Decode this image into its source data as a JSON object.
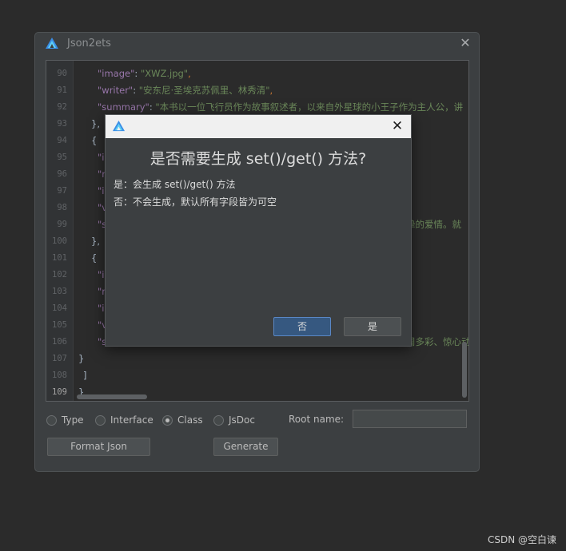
{
  "window": {
    "title": "Json2ets",
    "close_icon": "close-icon"
  },
  "editor": {
    "lines": [
      {
        "num": "90",
        "key": "\"image\"",
        "sep": ": ",
        "val": "\"XWZ.jpg\"",
        "tail": ","
      },
      {
        "num": "91",
        "key": "\"writer\"",
        "sep": ": ",
        "val": "\"安东尼·圣埃克苏佩里、林秀清\"",
        "tail": ","
      },
      {
        "num": "92",
        "key": "\"summary\"",
        "sep": ": ",
        "val": "\"本书以一位飞行员作为故事叙述者，以来自外星球的小王子作为主人公，讲",
        "tail": ""
      },
      {
        "num": "93",
        "plain": "},"
      },
      {
        "num": "94",
        "plain": "{"
      },
      {
        "num": "95",
        "key": "\"i",
        "sep": "",
        "val": "",
        "tail": ""
      },
      {
        "num": "96",
        "key": "\"r",
        "sep": "",
        "val": "",
        "tail": ""
      },
      {
        "num": "97",
        "key": "\"i",
        "sep": "",
        "val": "",
        "tail": ""
      },
      {
        "num": "98",
        "key": "\"v",
        "sep": "",
        "val": "",
        "tail": ""
      },
      {
        "num": "99",
        "key": "\"s",
        "sep": "",
        "val": "",
        "tail": "",
        "right": "挚的爱情。就"
      },
      {
        "num": "100",
        "plain": "},"
      },
      {
        "num": "101",
        "plain": "{"
      },
      {
        "num": "102",
        "key": "\"i",
        "sep": "",
        "val": "",
        "tail": ""
      },
      {
        "num": "103",
        "key": "\"r",
        "sep": "",
        "val": "",
        "tail": ""
      },
      {
        "num": "104",
        "key": "\"i",
        "sep": "",
        "val": "",
        "tail": ""
      },
      {
        "num": "105",
        "key": "\"v",
        "sep": "",
        "val": "",
        "tail": ""
      },
      {
        "num": "106",
        "key": "\"s",
        "sep": "",
        "val": "",
        "tail": "",
        "right": "周多彩、惊心动"
      },
      {
        "num": "107",
        "plain": "}"
      },
      {
        "num": "108",
        "plain": "]"
      },
      {
        "num": "109",
        "plain": "}"
      }
    ]
  },
  "options": {
    "radios": [
      {
        "label": "Type",
        "checked": false
      },
      {
        "label": "Interface",
        "checked": false
      },
      {
        "label": "Class",
        "checked": true
      },
      {
        "label": "JsDoc",
        "checked": false
      }
    ],
    "root_name_label": "Root name:",
    "root_name_value": ""
  },
  "buttons": {
    "format_json": "Format Json",
    "generate": "Generate"
  },
  "dialog": {
    "heading": "是否需要生成 set()/get() 方法?",
    "line_yes": "是：会生成 set()/get() 方法",
    "line_no": "否：不会生成，默认所有字段皆为可空",
    "btn_no": "否",
    "btn_yes": "是"
  },
  "watermark": "CSDN @空白谏",
  "colors": {
    "accent": "#365880",
    "key": "#9876aa",
    "string": "#6a8759"
  }
}
